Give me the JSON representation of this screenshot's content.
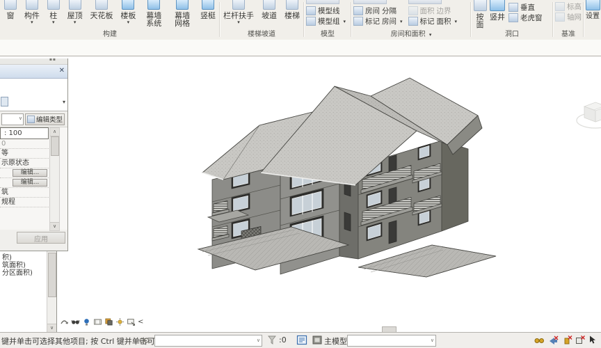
{
  "glyphs": {
    "menu_arrow": "▾",
    "combo_arrow": "∨",
    "scroll_up": "∧",
    "scroll_down": "∨",
    "collapse_left": "<",
    "close": "✕",
    "dots": "▪▪"
  },
  "ribbon": {
    "build": {
      "label": "构建",
      "buttons": [
        "窗",
        "构件",
        "柱",
        "屋顶",
        "天花板",
        "楼板",
        "幕墙 系统",
        "幕墙 网格",
        "竖梃"
      ]
    },
    "circulation": {
      "label": "楼梯坡道",
      "buttons": [
        "栏杆扶手",
        "坡道",
        "楼梯"
      ]
    },
    "model": {
      "label": "模型",
      "rows": [
        "模型线",
        "模型组"
      ]
    },
    "room_area": {
      "label": "房间和面积",
      "room": "房间",
      "separator": "分隔",
      "tag1": "标记",
      "room2": "房间",
      "area": "面积",
      "boundary": "边界",
      "tag2": "标记",
      "area2": "面积"
    },
    "opening": {
      "label": "洞口",
      "by_face": "按 面",
      "shaft": "竖井",
      "vertical": "垂直",
      "dormer": "老虎窗"
    },
    "datum": {
      "label": "基准",
      "level": "标高",
      "grid": "轴网"
    },
    "workplane": {
      "settings": "设置"
    }
  },
  "properties_palette": {
    "edit_type_label": "编辑类型",
    "rows": [
      {
        "value": ": 100"
      },
      {
        "value": "0"
      },
      {
        "value": "等"
      },
      {
        "value": "示原状态"
      },
      {
        "value": "编辑..."
      },
      {
        "value": "编辑..."
      },
      {
        "value": "筑"
      },
      {
        "value": "规程"
      }
    ],
    "apply_label": "应用"
  },
  "project_browser": {
    "items": [
      "积)",
      "筑面积)",
      "分区面积)"
    ]
  },
  "status_bar": {
    "message": "键并单击可选择其他项目; 按 Ctrl 键并单击可",
    "selection_count": ":0",
    "active_option": "主模型"
  },
  "model_view": {
    "wall_color": "#8c8c88",
    "wall_shade_color": "#6e6e69",
    "roof_color": "#c9c8c4",
    "glass_color": "#c7d0d7",
    "slab_color": "#b9b8b4"
  }
}
